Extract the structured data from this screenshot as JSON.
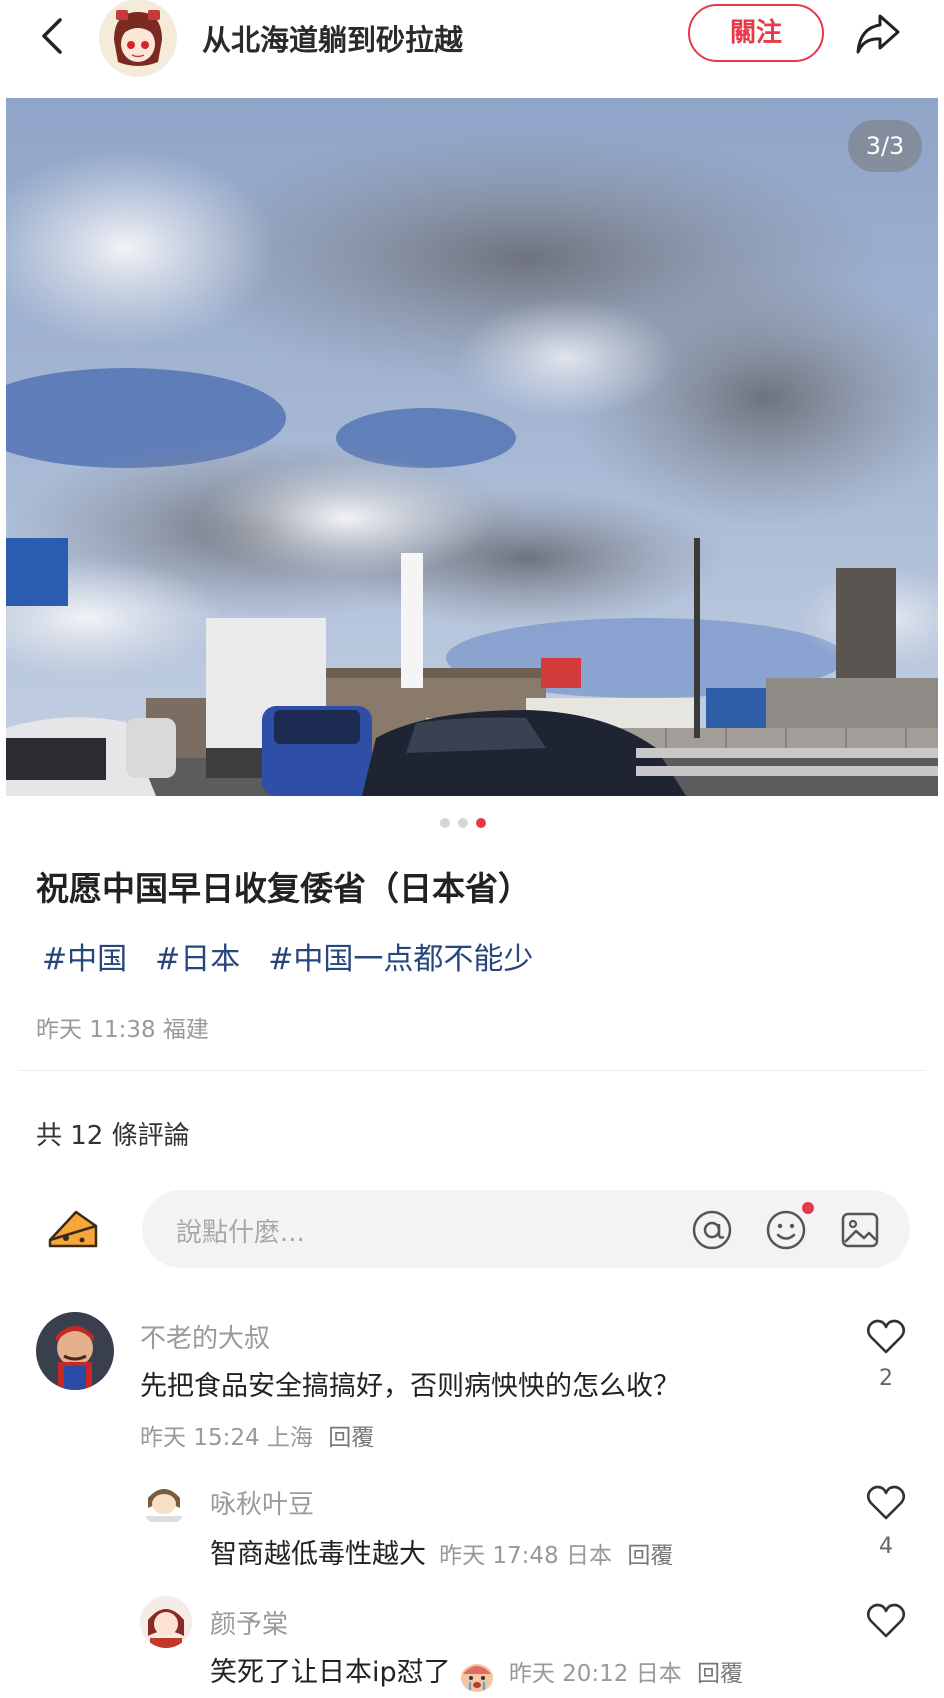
{
  "header": {
    "author_name": "从北海道躺到砂拉越",
    "follow_label": "關注"
  },
  "photo": {
    "counter": "3/3",
    "current_index": 3,
    "total": 3
  },
  "post": {
    "title": "祝愿中国早日收复倭省（日本省）",
    "tags": [
      "#中国",
      "#日本",
      "#中国一点都不能少"
    ],
    "time": "昨天 11:38",
    "location": "福建"
  },
  "comments_section": {
    "count_label": "共 12 條評論",
    "input_placeholder": "說點什麼..."
  },
  "comments": [
    {
      "user": "不老的大叔",
      "text": "先把食品安全搞搞好，否则病怏怏的怎么收？",
      "time": "昨天 15:24",
      "location": "上海",
      "reply_label": "回覆",
      "likes": "2"
    },
    {
      "user": "咏秋叶豆",
      "text": "智商越低毒性越大",
      "time": "昨天 17:48",
      "location": "日本",
      "reply_label": "回覆",
      "likes": "4"
    },
    {
      "user": "颜予棠",
      "text": "笑死了让日本ip怼了",
      "time": "昨天 20:12",
      "location": "日本",
      "reply_label": "回覆",
      "likes": ""
    }
  ],
  "colors": {
    "accent": "#e63a4b",
    "tag": "#27477c",
    "muted": "#999999"
  },
  "icons": [
    "back-arrow-icon",
    "share-icon",
    "at-icon",
    "emoji-icon",
    "image-icon",
    "heart-icon",
    "cheese-icon"
  ]
}
